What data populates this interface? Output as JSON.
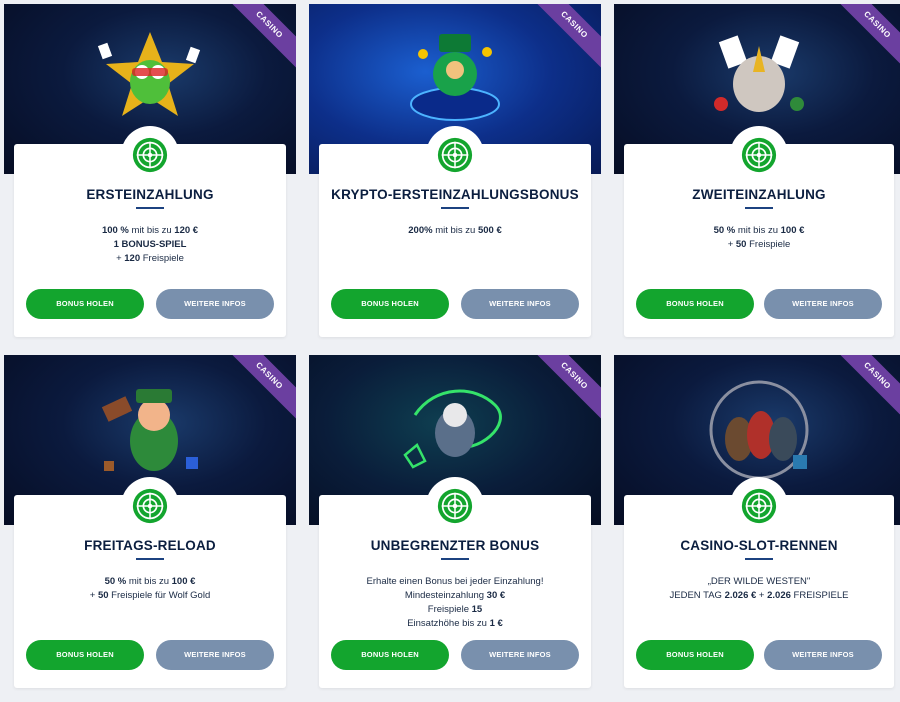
{
  "ribbon_label": "CASINO",
  "buttons": {
    "claim": "BONUS HOLEN",
    "info": "WEITERE INFOS"
  },
  "cards": [
    {
      "title": "ERSTEINZAHLUNG",
      "art": "frog-slot-character",
      "lines": [
        [
          {
            "t": "100 % ",
            "b": true
          },
          {
            "t": "mit bis zu ",
            "b": false
          },
          {
            "t": "120 €",
            "b": true
          }
        ],
        [
          {
            "t": "1 BONUS-SPIEL",
            "b": true
          }
        ],
        [
          {
            "t": "+ ",
            "b": false
          },
          {
            "t": "120",
            "b": true
          },
          {
            "t": " Freispiele",
            "b": false
          }
        ]
      ]
    },
    {
      "title": "KRYPTO-ERSTEINZAHLUNGSBONUS",
      "art": "leprechaun-crypto-character",
      "lines": [
        [
          {
            "t": "200%",
            "b": true
          },
          {
            "t": " mit bis zu ",
            "b": false
          },
          {
            "t": "500 €",
            "b": true
          }
        ]
      ]
    },
    {
      "title": "ZWEITEINZAHLUNG",
      "art": "rhino-cards-character",
      "lines": [
        [
          {
            "t": "50 %",
            "b": true
          },
          {
            "t": " mit bis zu ",
            "b": false
          },
          {
            "t": "100 €",
            "b": true
          }
        ],
        [
          {
            "t": "+ ",
            "b": false
          },
          {
            "t": "50",
            "b": true
          },
          {
            "t": " Freispiele",
            "b": false
          }
        ]
      ]
    },
    {
      "title": "FREITAGS-RELOAD",
      "art": "leprechaun-hammer-character",
      "lines": [
        [
          {
            "t": "50 %",
            "b": true
          },
          {
            "t": " mit bis zu ",
            "b": false
          },
          {
            "t": "100 €",
            "b": true
          }
        ],
        [
          {
            "t": "+ ",
            "b": false
          },
          {
            "t": "50",
            "b": true
          },
          {
            "t": " Freispiele für Wolf Gold",
            "b": false
          }
        ]
      ]
    },
    {
      "title": "UNBEGRENZTER BONUS",
      "art": "wizard-neon-character",
      "lines": [
        [
          {
            "t": "Erhalte einen Bonus bei jeder Einzahlung!",
            "b": false
          }
        ],
        [
          {
            "t": "Mindesteinzahlung ",
            "b": false
          },
          {
            "t": "30 €",
            "b": true
          }
        ],
        [
          {
            "t": "Freispiele ",
            "b": false
          },
          {
            "t": "15",
            "b": true
          }
        ],
        [
          {
            "t": "Einsatzhöhe bis zu ",
            "b": false
          },
          {
            "t": "1 €",
            "b": true
          }
        ]
      ]
    },
    {
      "title": "CASINO-SLOT-RENNEN",
      "art": "wild-west-characters",
      "lines": [
        [
          {
            "t": "„DER WILDE WESTEN\"",
            "b": false
          }
        ],
        [
          {
            "t": "JEDEN TAG ",
            "b": false
          },
          {
            "t": "2.026 €",
            "b": true
          },
          {
            "t": " + ",
            "b": false
          },
          {
            "t": "2.026",
            "b": true
          },
          {
            "t": " FREISPIELE",
            "b": false
          }
        ]
      ]
    }
  ],
  "colors": {
    "claim": "#13a52e",
    "info": "#7990ad",
    "ribbon": "#6b3fa0",
    "title": "#0b1e3f"
  }
}
